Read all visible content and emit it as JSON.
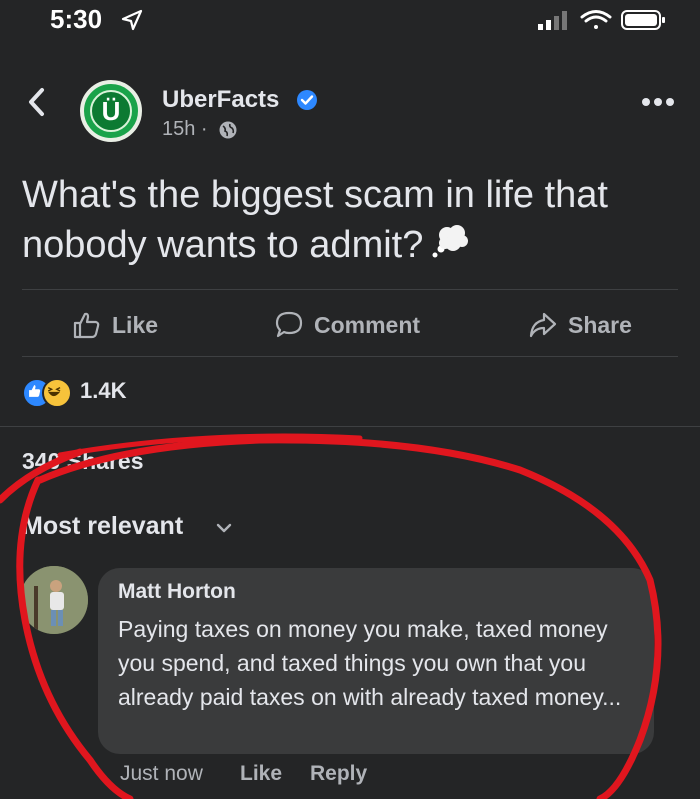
{
  "status_bar": {
    "time": "5:30"
  },
  "header": {
    "page_name": "UberFacts",
    "avatar_letter": "Ü",
    "post_time": "15h ·"
  },
  "post": {
    "text": "What's the biggest scam in life that nobody wants to admit?"
  },
  "actions": {
    "like_label": "Like",
    "comment_label": "Comment",
    "share_label": "Share"
  },
  "reactions": {
    "count": "1.4K"
  },
  "shares": {
    "label": "340 Shares"
  },
  "comments": {
    "sort_label": "Most relevant",
    "items": [
      {
        "author": "Matt Horton",
        "text": "Paying taxes on money you make, taxed money you spend, and taxed things you own that you already paid taxes on with already taxed money...",
        "time": "Just now",
        "like_label": "Like",
        "reply_label": "Reply"
      }
    ]
  },
  "colors": {
    "background": "#242526",
    "bubble": "#3a3b3c",
    "accent_blue": "#2d88ff",
    "annotation_red": "#e0161e",
    "brand_green": "#1aa34a"
  }
}
